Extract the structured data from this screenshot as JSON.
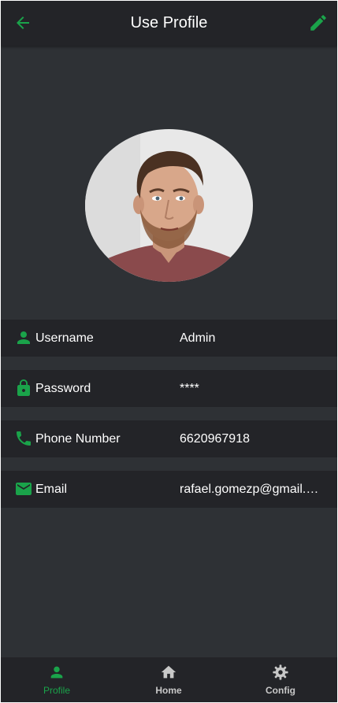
{
  "header": {
    "title": "Use Profile"
  },
  "fields": [
    {
      "label": "Username",
      "value": "Admin"
    },
    {
      "label": "Password",
      "value": "****"
    },
    {
      "label": "Phone Number",
      "value": "6620967918"
    },
    {
      "label": "Email",
      "value": "rafael.gomezp@gmail.com"
    }
  ],
  "nav": [
    {
      "label": "Profile",
      "icon": "person-icon",
      "active": true
    },
    {
      "label": "Home",
      "icon": "home-icon",
      "active": false
    },
    {
      "label": "Config",
      "icon": "settings-icon",
      "active": false
    }
  ],
  "colors": {
    "accent": "#1aa34a",
    "background": "#2e3135",
    "surface": "#232428",
    "text": "#ffffff",
    "inactive": "#c8c8c8"
  }
}
